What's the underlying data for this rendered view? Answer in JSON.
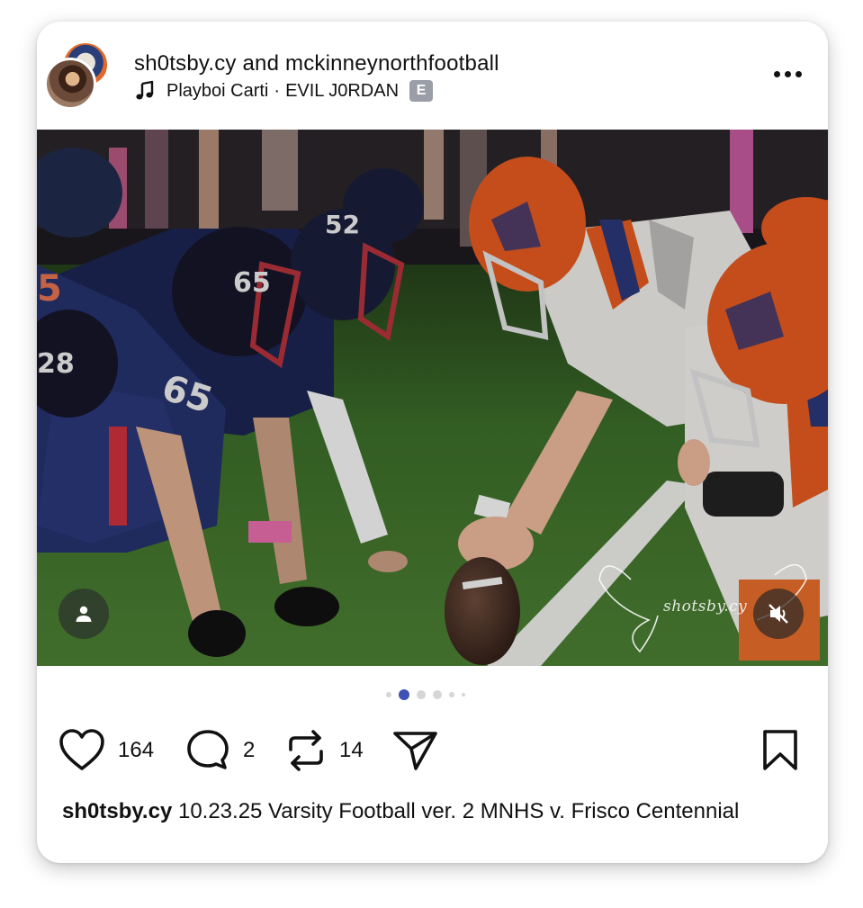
{
  "post": {
    "author": "sh0tsby.cy",
    "joiner": "and",
    "collaborator": "mckinneynorthfootball",
    "music": {
      "artist": "Playboi Carti",
      "separator": "·",
      "track": "EVIL J0RDAN",
      "explicit_badge": "E"
    },
    "watermark": "shotsby.cy",
    "carousel": {
      "count": 6,
      "active_index": 1
    },
    "stats": {
      "likes": "164",
      "comments": "2",
      "reposts": "14"
    },
    "caption": {
      "username": "sh0tsby.cy",
      "text": "10.23.25 Varsity Football ver. 2 MNHS v. Frisco Centennial"
    }
  },
  "icons": {
    "music": "music-note-icon",
    "more": "more-dots-icon",
    "tag": "person-tag-icon",
    "mute": "speaker-muted-icon",
    "like": "heart-icon",
    "comment": "comment-bubble-icon",
    "repost": "repost-icon",
    "share": "paper-plane-icon",
    "save": "bookmark-icon"
  },
  "colors": {
    "active_dot": "#3f51b5",
    "inactive_dot": "#d6d6d6",
    "explicit_badge": "#9a9ea6",
    "home_team_helmet": "#1c1c3a",
    "away_team_helmet": "#e0581f"
  }
}
